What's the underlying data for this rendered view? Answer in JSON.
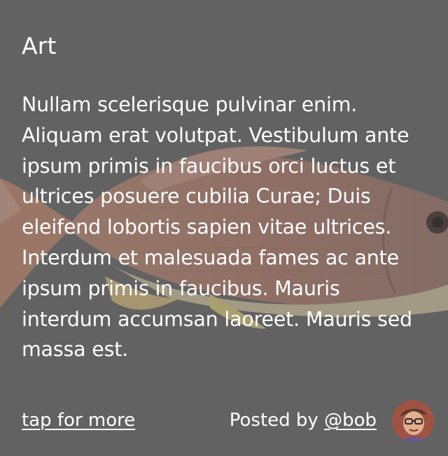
{
  "card": {
    "title": "Art",
    "body": "Nullam scelerisque pulvinar enim. Aliquam erat volutpat. Vestibulum ante ipsum primis in faucibus orci luctus et ultrices posuere cubilia Curae; Duis eleifend lobortis sapien vitae ultrices. Interdum et malesuada fames ac ante ipsum primis in faucibus. Mauris interdum accumsan laoreet. Mauris sed massa est.",
    "background_icon": "fish-illustration",
    "background_color": "#626262"
  },
  "footer": {
    "tap_label": "tap for more",
    "posted_prefix": "Posted by ",
    "author_handle": "@bob",
    "avatar_icon": "avatar-icon"
  }
}
